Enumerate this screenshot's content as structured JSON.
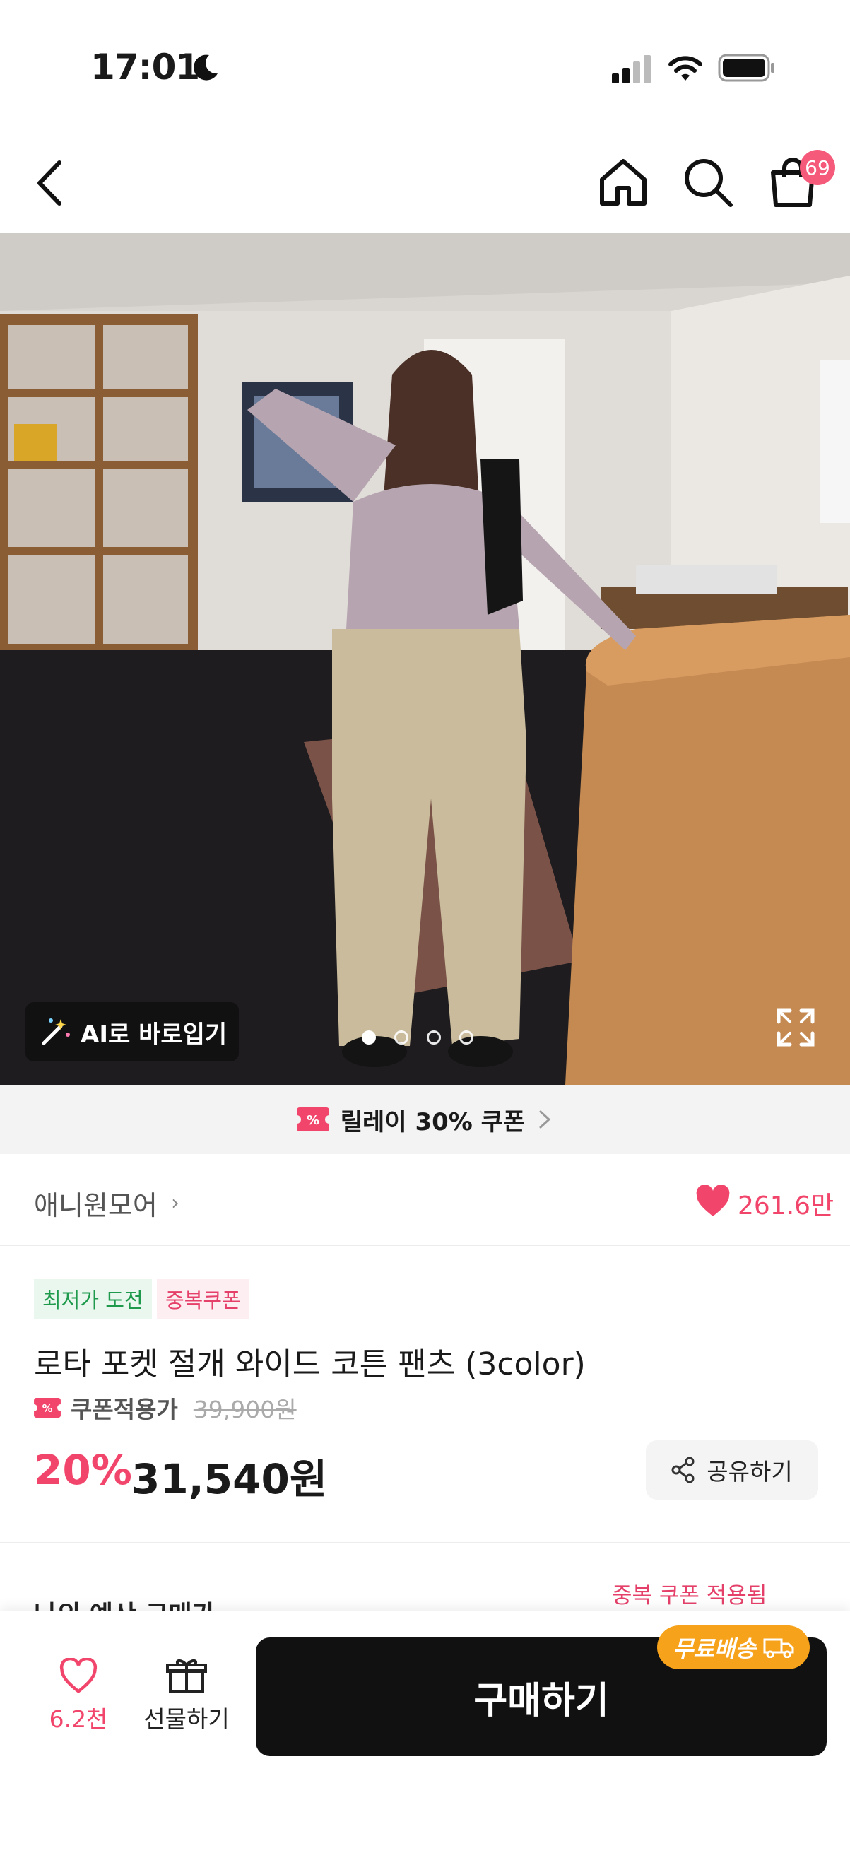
{
  "status_bar": {
    "time": "17:01"
  },
  "nav": {
    "cart_count": "69"
  },
  "hero": {
    "ai_button_label": "AI로 바로입기",
    "image_count": 4,
    "active_index": 0
  },
  "relay_coupon": {
    "label": "릴레이 30% 쿠폰"
  },
  "store": {
    "name": "애니원모어",
    "likes": "261.6만"
  },
  "product": {
    "tags": [
      "최저가 도전",
      "중복쿠폰"
    ],
    "title": "로타 포켓 절개 와이드 코튼 팬츠 (3color)",
    "coupon_label": "쿠폰적용가",
    "original_price": "39,900원",
    "discount": "20%",
    "price": "31,540원",
    "share_label": "공유하기"
  },
  "duplicate_coupon": "중복 쿠폰 적용됨",
  "budget_label": "나의 예산 구매가",
  "bottom_bar": {
    "wish_count": "6.2천",
    "gift_label": "선물하기",
    "buy_label": "구매하기",
    "free_shipping": "무료배송"
  },
  "colors": {
    "accent": "#f2456b",
    "buy_bg": "#111111",
    "free_ship": "#f7a21b"
  }
}
